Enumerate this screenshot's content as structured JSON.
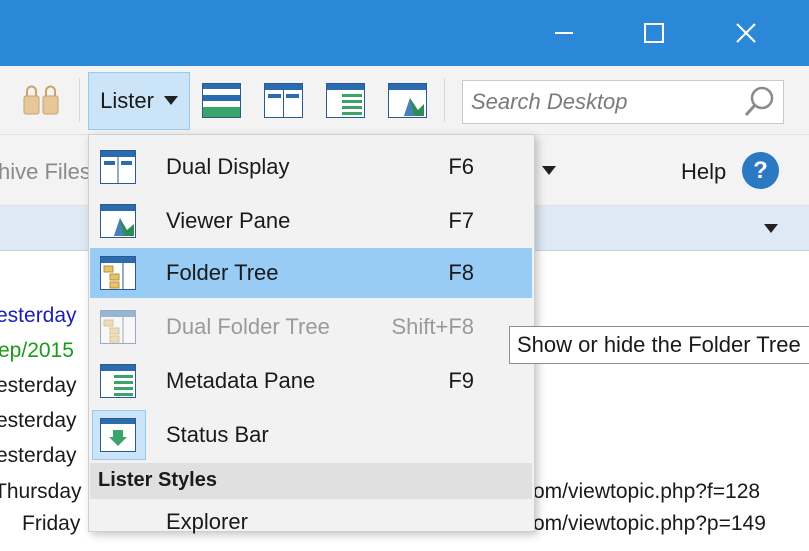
{
  "window": {
    "controls": {
      "minimize_icon": "minimize-icon",
      "maximize_icon": "maximize-icon",
      "close_icon": "close-icon"
    }
  },
  "toolbar": {
    "lister_label": "Lister",
    "search_placeholder": "Search Desktop"
  },
  "second_bar": {
    "archive_label": "hive Files",
    "help_label": "Help",
    "help_icon": "?"
  },
  "menu": {
    "items": [
      {
        "label": "Dual Display",
        "shortcut": "F6",
        "icon": "dual-display-icon",
        "state": "normal"
      },
      {
        "label": "Viewer Pane",
        "shortcut": "F7",
        "icon": "viewer-pane-icon",
        "state": "normal"
      },
      {
        "label": "Folder Tree",
        "shortcut": "F8",
        "icon": "folder-tree-icon",
        "state": "highlighted"
      },
      {
        "label": "Dual Folder Tree",
        "shortcut": "Shift+F8",
        "icon": "dual-folder-tree-icon",
        "state": "disabled"
      },
      {
        "label": "Metadata Pane",
        "shortcut": "F9",
        "icon": "metadata-pane-icon",
        "state": "normal"
      },
      {
        "label": "Status Bar",
        "shortcut": "",
        "icon": "status-bar-icon",
        "state": "checked"
      }
    ],
    "section_label": "Lister Styles",
    "styles": [
      {
        "label": "Explorer"
      }
    ]
  },
  "tooltip": {
    "text": "Show or hide the Folder Tree"
  },
  "file_list": {
    "left_column": [
      {
        "text": "esterday",
        "color": "#1c1cb8"
      },
      {
        "text": "ep/2015",
        "color": "#1b9a1b"
      },
      {
        "text": "esterday",
        "color": "#1a1a1a"
      },
      {
        "text": "esterday",
        "color": "#1a1a1a"
      },
      {
        "text": "esterday",
        "color": "#1a1a1a"
      },
      {
        "text": "Thursday",
        "color": "#1a1a1a"
      },
      {
        "text": "Friday",
        "color": "#1a1a1a"
      }
    ],
    "right_column": [
      {
        "text": "om/viewtopic.php?f=128"
      },
      {
        "text": "om/viewtopic.php?p=149"
      }
    ]
  },
  "colors": {
    "titlebar": "#2b88d8",
    "accent": "#2b79c2",
    "highlight": "#99ccf5"
  }
}
